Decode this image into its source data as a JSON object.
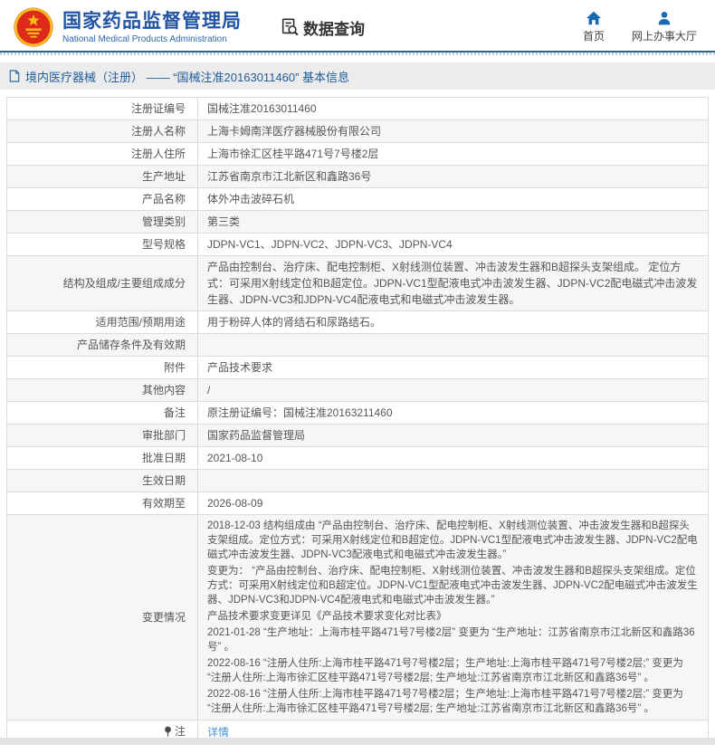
{
  "header": {
    "title_cn": "国家药品监督管理局",
    "title_en": "National Medical Products Administration",
    "section_label": "数据查询",
    "nav": [
      {
        "label": "首页",
        "icon": "home-icon"
      },
      {
        "label": "网上办事大厅",
        "icon": "person-icon"
      }
    ],
    "accent_color": "#2155a3",
    "icon_color": "#1a68af"
  },
  "breadcrumb": {
    "icon": "document-icon",
    "text": "境内医疗器械（注册） —— “国械注准20163011460” 基本信息"
  },
  "table": {
    "rows": [
      {
        "label": "注册证编号",
        "value": "国械注准20163011460"
      },
      {
        "label": "注册人名称",
        "value": "上海卡姆南洋医疗器械股份有限公司"
      },
      {
        "label": "注册人住所",
        "value": "上海市徐汇区桂平路471号7号楼2层"
      },
      {
        "label": "生产地址",
        "value": "江苏省南京市江北新区和鑫路36号"
      },
      {
        "label": "产品名称",
        "value": "体外冲击波碎石机"
      },
      {
        "label": "管理类别",
        "value": "第三类"
      },
      {
        "label": "型号规格",
        "value": "JDPN-VC1、JDPN-VC2、JDPN-VC3、JDPN-VC4"
      },
      {
        "label": "结构及组成/主要组成成分",
        "value": "产品由控制台、治疗床、配电控制柜、X射线测位装置、冲击波发生器和B超探头支架组成。 定位方式：可采用X射线定位和B超定位。JDPN-VC1型配液电式冲击波发生器、JDPN-VC2配电磁式冲击波发生器、JDPN-VC3和JDPN-VC4配液电式和电磁式冲击波发生器。"
      },
      {
        "label": "适用范围/预期用途",
        "value": "用于粉碎人体的肾结石和尿路结石。"
      },
      {
        "label": "产品储存条件及有效期",
        "value": ""
      },
      {
        "label": "附件",
        "value": "产品技术要求"
      },
      {
        "label": "其他内容",
        "value": "/"
      },
      {
        "label": "备注",
        "value": "原注册证编号：国械注准20163211460"
      },
      {
        "label": "审批部门",
        "value": "国家药品监督管理局"
      },
      {
        "label": "批准日期",
        "value": "2021-08-10"
      },
      {
        "label": "生效日期",
        "value": ""
      },
      {
        "label": "有效期至",
        "value": "2026-08-09"
      },
      {
        "label": "变更情况",
        "value": [
          "2018-12-03 结构组成由 “产品由控制台、治疗床、配电控制柜、X射线测位装置、冲击波发生器和B超探头支架组成。定位方式：可采用X射线定位和B超定位。JDPN-VC1型配液电式冲击波发生器、JDPN-VC2配电磁式冲击波发生器、JDPN-VC3配液电式和电磁式冲击波发生器。”",
          "变更为： “产品由控制台、治疗床、配电控制柜、X射线测位装置、冲击波发生器和B超探头支架组成。定位方式：可采用X射线定位和B超定位。JDPN-VC1型配液电式冲击波发生器、JDPN-VC2配电磁式冲击波发生器、JDPN-VC3和JDPN-VC4配液电式和电磁式冲击波发生器。”",
          "产品技术要求变更详见《产品技术要求变化对比表》",
          "2021-01-28 “生产地址：上海市桂平路471号7号楼2层” 变更为 “生产地址：江苏省南京市江北新区和鑫路36号” 。",
          "2022-08-16 “注册人住所:上海市桂平路471号7号楼2层；生产地址:上海市桂平路471号7号楼2层;” 变更为 “注册人住所:上海市徐汇区桂平路471号7号楼2层; 生产地址:江苏省南京市江北新区和鑫路36号” 。",
          "2022-08-16 “注册人住所:上海市桂平路471号7号楼2层；生产地址:上海市桂平路471号7号楼2层;” 变更为 “注册人住所:上海市徐汇区桂平路471号7号楼2层; 生产地址:江苏省南京市江北新区和鑫路36号” 。"
        ]
      },
      {
        "label": "注",
        "icon": "pin-icon",
        "link": true,
        "value": "详情"
      }
    ]
  }
}
